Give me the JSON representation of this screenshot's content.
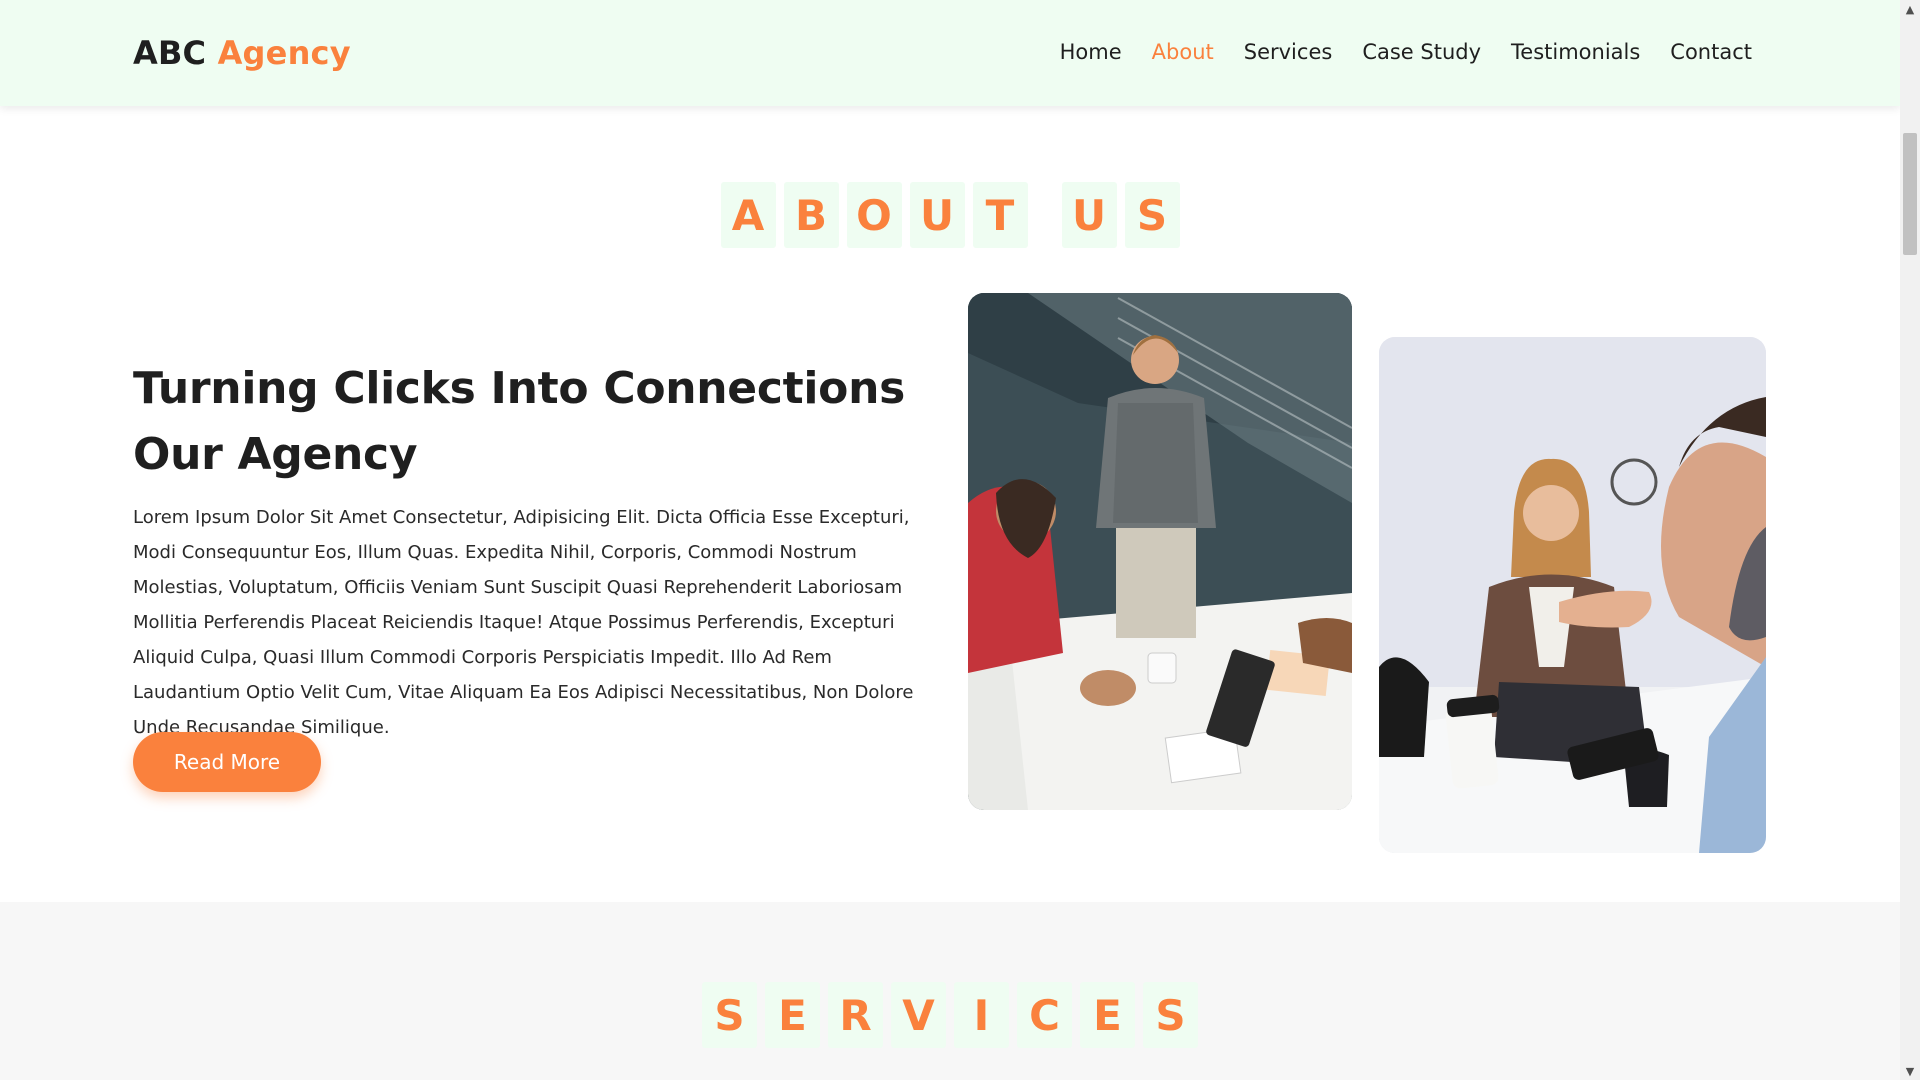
{
  "brand": {
    "part1": "ABC",
    "part2": "Agency"
  },
  "nav": [
    {
      "label": "Home",
      "active": false
    },
    {
      "label": "About",
      "active": true
    },
    {
      "label": "Services",
      "active": false
    },
    {
      "label": "Case Study",
      "active": false
    },
    {
      "label": "Testimonials",
      "active": false
    },
    {
      "label": "Contact",
      "active": false
    }
  ],
  "about": {
    "title_letters": [
      "A",
      "B",
      "O",
      "U",
      "T",
      "",
      "U",
      "S"
    ],
    "heading": "Turning Clicks Into Connections Our Agency",
    "body": "Lorem Ipsum Dolor Sit Amet Consectetur, Adipisicing Elit. Dicta Officia Esse Excepturi, Modi Consequuntur Eos, Illum Quas. Expedita Nihil, Corporis, Commodi Nostrum Molestias, Voluptatum, Officiis Veniam Sunt Suscipit Quasi Reprehenderit Laboriosam Mollitia Perferendis Placeat Reiciendis Itaque! Atque Possimus Perferendis, Excepturi Aliquid Culpa, Quasi Illum Commodi Corporis Perspiciatis Impedit. Illo Ad Rem Laudantium Optio Velit Cum, Vitae Aliquam Ea Eos Adipisci Necessitatibus, Non Dolore Unde Recusandae Similique.",
    "button_label": "Read More"
  },
  "services": {
    "title_letters": [
      "S",
      "E",
      "R",
      "V",
      "I",
      "C",
      "E",
      "S"
    ]
  },
  "colors": {
    "accent": "#fa813d",
    "header_bg": "#effdf2",
    "section_alt_bg": "#f7f7f7"
  },
  "scrollbar": {
    "up_icon": "triangle-up-icon",
    "down_icon": "triangle-down-icon"
  }
}
